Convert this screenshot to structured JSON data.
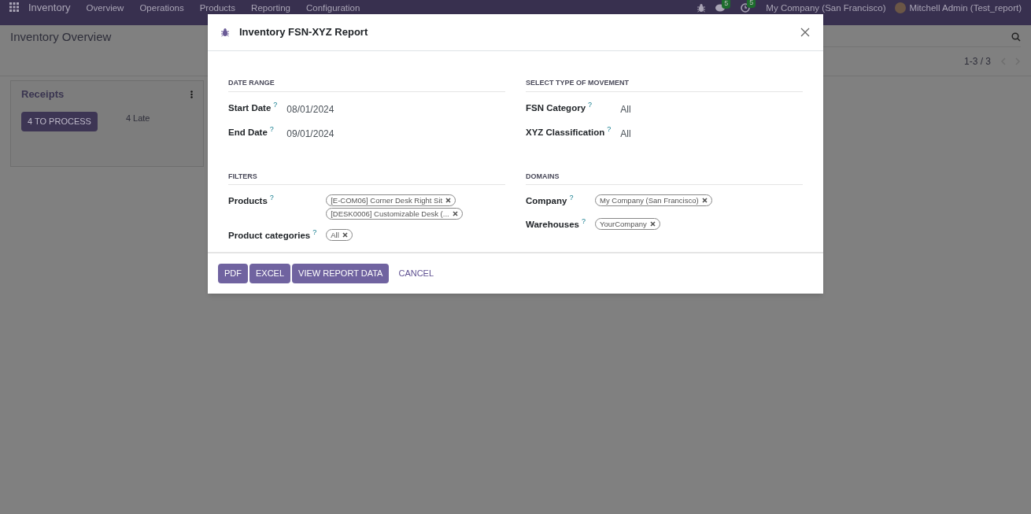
{
  "navbar": {
    "app": "Inventory",
    "menu": [
      "Overview",
      "Operations",
      "Products",
      "Reporting",
      "Configuration"
    ],
    "messages_count": "5",
    "activities_count": "5",
    "company": "My Company (San Francisco)",
    "user": "Mitchell Admin (Test_report)"
  },
  "page": {
    "title": "Inventory Overview",
    "pager": "1-3 / 3"
  },
  "card": {
    "title": "Receipts",
    "button": "4 TO PROCESS",
    "late": "4 Late"
  },
  "dialog": {
    "title": "Inventory FSN-XYZ Report",
    "sections": [
      {
        "title": "DATE RANGE",
        "fields": [
          {
            "label": "Start Date",
            "help": "?",
            "kind": "text",
            "value": "08/01/2024"
          },
          {
            "label": "End Date",
            "help": "?",
            "kind": "text",
            "value": "09/01/2024"
          }
        ]
      },
      {
        "title": "SELECT TYPE OF MOVEMENT",
        "fields": [
          {
            "label": "FSN Category",
            "help": "?",
            "kind": "text",
            "value": "All"
          },
          {
            "label": "XYZ Classification",
            "help": "?",
            "kind": "text",
            "value": "All"
          }
        ]
      },
      {
        "title": "FILTERS",
        "fields": [
          {
            "label": "Products",
            "help": "?",
            "kind": "tags",
            "tags": [
              "[E-COM06] Corner Desk Right Sit",
              "[DESK0006] Customizable Desk (..."
            ]
          },
          {
            "label": "Product categories",
            "help": "?",
            "kind": "tags",
            "tags": [
              "All"
            ]
          }
        ]
      },
      {
        "title": "DOMAINS",
        "fields": [
          {
            "label": "Company",
            "help": "?",
            "kind": "tags",
            "tags": [
              "My Company (San Francisco)"
            ]
          },
          {
            "label": "Warehouses",
            "help": "?",
            "kind": "tags",
            "tags": [
              "YourCompany"
            ]
          }
        ]
      }
    ],
    "buttons": [
      {
        "label": "PDF",
        "kind": "primary"
      },
      {
        "label": "EXCEL",
        "kind": "primary"
      },
      {
        "label": "VIEW REPORT DATA",
        "kind": "primary"
      },
      {
        "label": "CANCEL",
        "kind": "link"
      }
    ]
  }
}
